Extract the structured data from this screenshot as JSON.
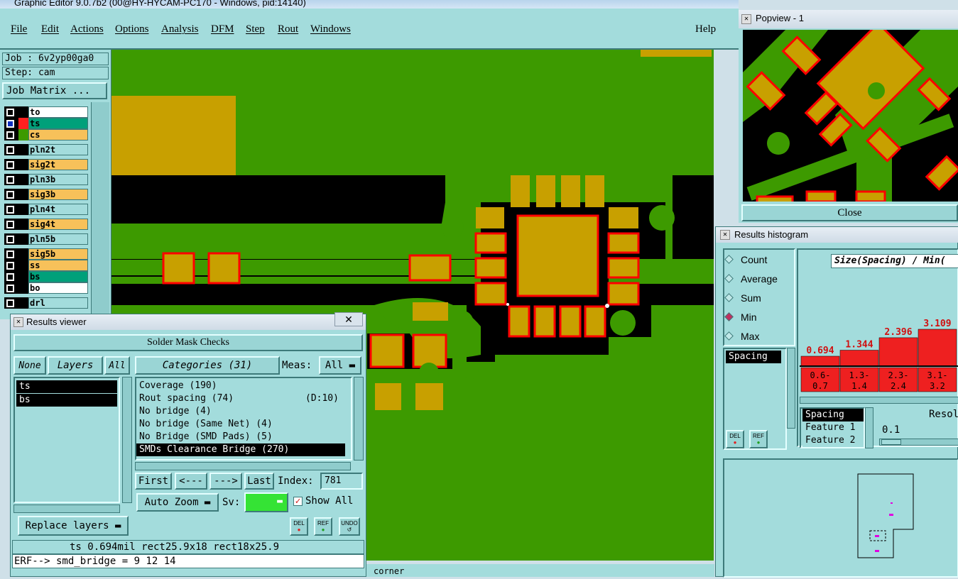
{
  "window_title": "Graphic Editor 9.0.7b2 (00@HY-HYCAM-PC170 - Windows, pid:14140)",
  "menubar": {
    "items": [
      "File",
      "Edit",
      "Actions",
      "Options",
      "Analysis",
      "DFM",
      "Step",
      "Rout",
      "Windows"
    ],
    "help": "Help"
  },
  "job": {
    "job_label": "Job : 6v2yp00ga0",
    "step_label": "Step: cam",
    "matrix_button": "Job Matrix ..."
  },
  "layers": [
    {
      "name": "to",
      "color": "#ffffff"
    },
    {
      "name": "ts",
      "color": "#00a07a"
    },
    {
      "name": "cs",
      "color": "#f7c15a"
    },
    {
      "name": "pln2t",
      "color": "#a3dcdc"
    },
    {
      "name": "sig2t",
      "color": "#f7c15a"
    },
    {
      "name": "pln3b",
      "color": "#a3dcdc"
    },
    {
      "name": "sig3b",
      "color": "#f7c15a"
    },
    {
      "name": "pln4t",
      "color": "#a3dcdc"
    },
    {
      "name": "sig4t",
      "color": "#f7c15a"
    },
    {
      "name": "pln5b",
      "color": "#a3dcdc"
    },
    {
      "name": "sig5b",
      "color": "#f7c15a"
    },
    {
      "name": "ss",
      "color": "#f7c15a"
    },
    {
      "name": "bs",
      "color": "#00a07a"
    },
    {
      "name": "bo",
      "color": "#ffffff"
    },
    {
      "name": "drl",
      "color": "#a3dcdc"
    }
  ],
  "results_viewer": {
    "title": "Results viewer",
    "header": "Solder Mask Checks",
    "none_btn": "None",
    "layers_btn": "Layers",
    "all_btn": "All",
    "categories_btn": "Categories (31)",
    "meas_label": "Meas:",
    "meas_value": "All",
    "layer_list": [
      "ts",
      "bs"
    ],
    "categories": [
      "Coverage (190)",
      "Rout spacing (74)",
      "No bridge (4)",
      "No bridge (Same Net) (4)",
      "No Bridge (SMD Pads) (5)",
      "SMDs Clearance Bridge (270)"
    ],
    "category_extra": "(D:10)",
    "first_btn": "First",
    "prev_btn": "<---",
    "next_btn": "--->",
    "last_btn": "Last",
    "index_label": "Index:",
    "index_value": "781",
    "auto_zoom": "Auto Zoom",
    "sv_label": "Sv:",
    "show_all": "Show All",
    "replace_layers": "Replace layers",
    "del": "DEL",
    "ref": "REF",
    "undo": "UNDO",
    "result_line": "ts 0.694mil  rect25.9x18  rect18x25.9",
    "erf_line": "ERF--> smd_bridge = 9 12 14"
  },
  "popview": {
    "title": "Popview - 1",
    "close_btn": "Close"
  },
  "histogram": {
    "title": "Results histogram",
    "radios": [
      "Count",
      "Average",
      "Sum",
      "Min",
      "Max"
    ],
    "selected": "Min",
    "metric_list": [
      "Spacing"
    ],
    "header": "Size(Spacing) / Min(",
    "bars": [
      {
        "label": "0.694",
        "range": "0.6-\n0.7",
        "value": 0.694
      },
      {
        "label": "1.344",
        "range": "1.3-\n1.4",
        "value": 1.344
      },
      {
        "label": "2.396",
        "range": "2.3-\n2.4",
        "value": 2.396
      },
      {
        "label": "3.109",
        "range": "3.1-\n3.2",
        "value": 3.109
      }
    ],
    "fields": [
      "Spacing",
      "Feature 1",
      "Feature 2"
    ],
    "resol_label": "Resol",
    "resol_value": "0.1",
    "del": "DEL",
    "ref": "REF"
  },
  "status": {
    "text": "corner"
  },
  "colors": {
    "panel": "#a3dcdc",
    "copper": "#3d9a00",
    "pad": "#c8a000",
    "highlight": "#ff0000"
  }
}
